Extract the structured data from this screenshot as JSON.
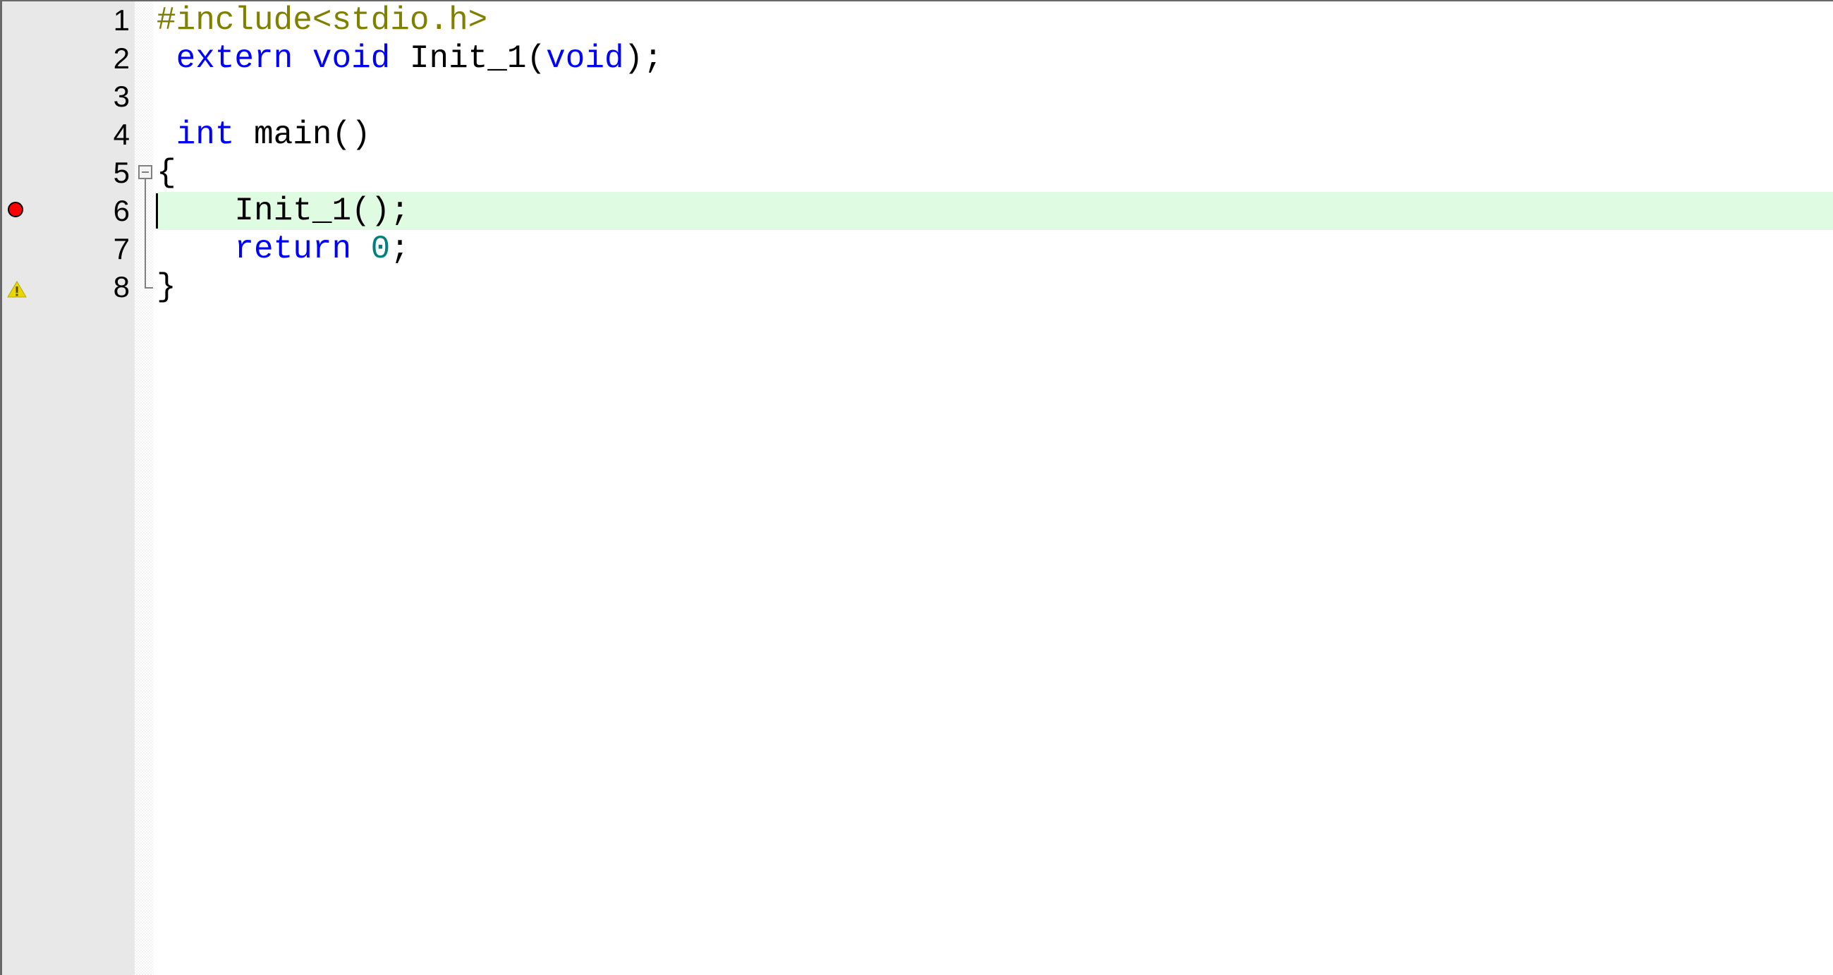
{
  "editor": {
    "colors": {
      "preprocessor": "#808000",
      "keyword": "#0000ff",
      "number": "#008080",
      "identifier": "#000000",
      "current_line_bg": "#dffce2",
      "gutter_bg": "#e8e8e8",
      "breakpoint": "#ff0000"
    },
    "current_line": 6,
    "lines": [
      {
        "number": "1",
        "tokens": [
          {
            "type": "pre",
            "text": "#include<stdio.h>"
          }
        ]
      },
      {
        "number": "2",
        "tokens": [
          {
            "type": "plain",
            "text": " "
          },
          {
            "type": "kw",
            "text": "extern"
          },
          {
            "type": "plain",
            "text": " "
          },
          {
            "type": "kw",
            "text": "void"
          },
          {
            "type": "plain",
            "text": " Init_1("
          },
          {
            "type": "kw",
            "text": "void"
          },
          {
            "type": "plain",
            "text": ");"
          }
        ]
      },
      {
        "number": "3",
        "tokens": []
      },
      {
        "number": "4",
        "tokens": [
          {
            "type": "plain",
            "text": " "
          },
          {
            "type": "kw",
            "text": "int"
          },
          {
            "type": "plain",
            "text": " main()"
          }
        ]
      },
      {
        "number": "5",
        "tokens": [
          {
            "type": "plain",
            "text": "{"
          }
        ],
        "fold": "start"
      },
      {
        "number": "6",
        "tokens": [
          {
            "type": "plain",
            "text": "    Init_1();"
          }
        ],
        "marker": "breakpoint-icon"
      },
      {
        "number": "7",
        "tokens": [
          {
            "type": "plain",
            "text": "    "
          },
          {
            "type": "kw",
            "text": "return"
          },
          {
            "type": "plain",
            "text": " "
          },
          {
            "type": "num",
            "text": "0"
          },
          {
            "type": "plain",
            "text": ";"
          }
        ]
      },
      {
        "number": "8",
        "tokens": [
          {
            "type": "plain",
            "text": "}"
          }
        ],
        "fold": "end",
        "marker": "warning-icon"
      }
    ]
  }
}
